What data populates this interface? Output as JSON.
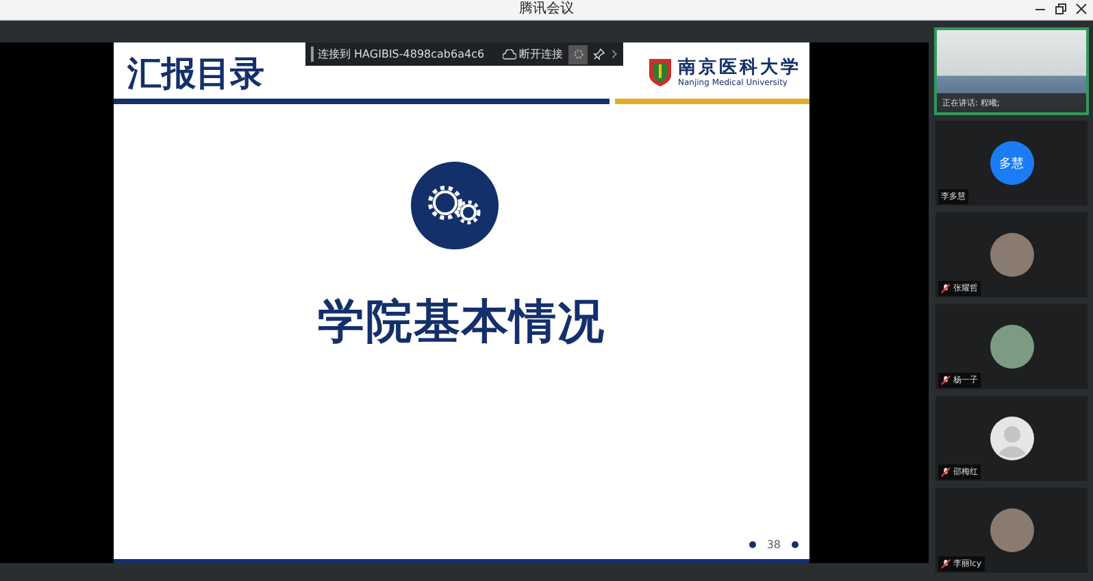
{
  "window": {
    "title": "腾讯会议"
  },
  "connection_bar": {
    "status": "连接到 HAGIBIS-4898cab6a4c6",
    "disconnect": "断开连接"
  },
  "slide": {
    "heading": "汇报目录",
    "logo_name": "南京医科大学",
    "logo_english": "Nanjing Medical University",
    "section_title": "学院基本情况",
    "page_number": "38"
  },
  "participants": [
    {
      "kind": "video",
      "label": "正在讲话: 程曦;",
      "speaking": true,
      "muted": false
    },
    {
      "kind": "initials",
      "initials": "多慧",
      "name": "李多慧",
      "speaking": false,
      "muted": false
    },
    {
      "kind": "photo",
      "name": "张耀哲",
      "speaking": false,
      "muted": true
    },
    {
      "kind": "photo",
      "name": "杨一子",
      "speaking": false,
      "muted": true
    },
    {
      "kind": "silhouette",
      "name": "邵梅红",
      "speaking": false,
      "muted": true
    },
    {
      "kind": "photo",
      "name": "李丽lcy",
      "speaking": false,
      "muted": true
    }
  ]
}
